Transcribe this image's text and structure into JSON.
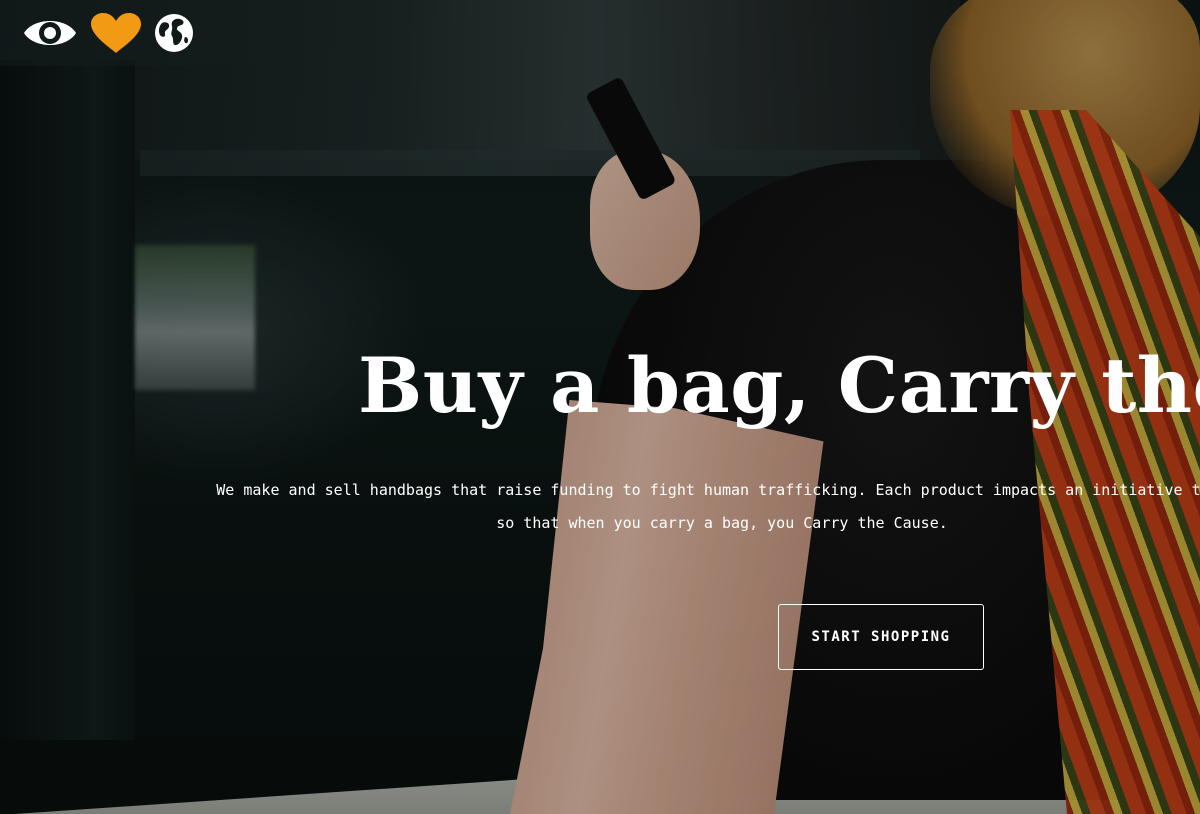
{
  "nav": {
    "icons": [
      {
        "name": "eye-icon",
        "color": "#ffffff"
      },
      {
        "name": "heart-icon",
        "color": "#f29a13"
      },
      {
        "name": "globe-icon",
        "color": "#ffffff"
      }
    ]
  },
  "hero": {
    "headline": "Buy a bag, Carry the Cause.",
    "subtext_line1": "We make and sell handbags that raise funding to fight human trafficking. Each product impacts an initiative that",
    "subtext_line2": "so that when you carry a bag, you Carry the Cause.",
    "cta_label": "START SHOPPING"
  },
  "colors": {
    "accent": "#f29a13",
    "text": "#ffffff"
  }
}
